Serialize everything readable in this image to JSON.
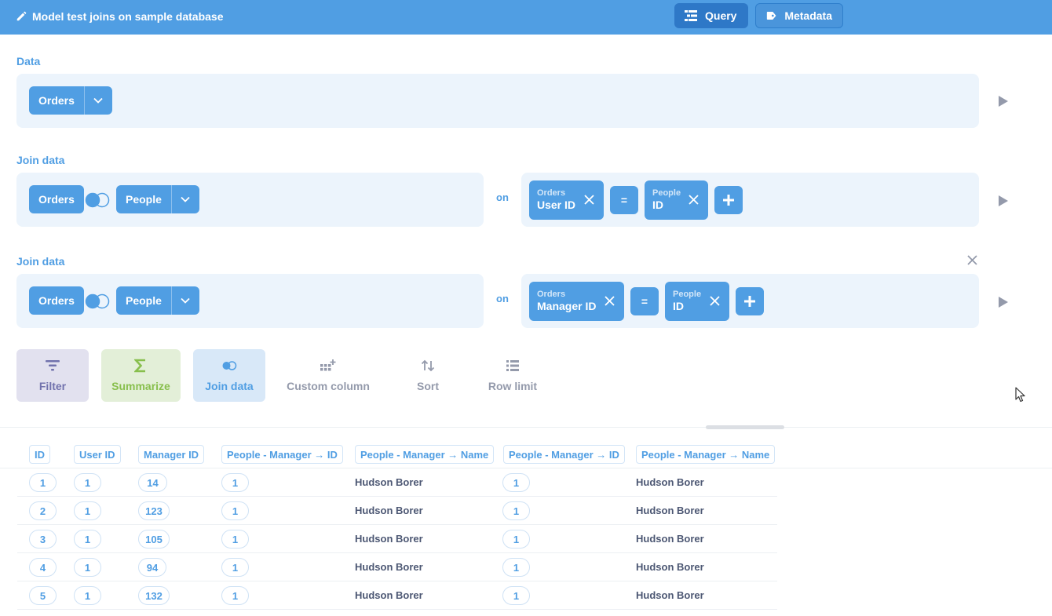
{
  "header": {
    "title": "Model test joins on sample database",
    "query_label": "Query",
    "metadata_label": "Metadata",
    "bg_color": "#509ee3"
  },
  "data_section": {
    "label": "Data",
    "table": "Orders"
  },
  "joins": [
    {
      "label": "Join data",
      "left_table": "Orders",
      "right_table": "People",
      "on_label": "on",
      "left_cond": {
        "table": "Orders",
        "field": "User ID"
      },
      "operator": "=",
      "right_cond": {
        "table": "People",
        "field": "ID"
      }
    },
    {
      "label": "Join data",
      "left_table": "Orders",
      "right_table": "People",
      "on_label": "on",
      "left_cond": {
        "table": "Orders",
        "field": "Manager ID"
      },
      "operator": "=",
      "right_cond": {
        "table": "People",
        "field": "ID"
      }
    }
  ],
  "actions": {
    "filter": "Filter",
    "summarize": "Summarize",
    "join": "Join data",
    "custom_column": "Custom column",
    "sort": "Sort",
    "row_limit": "Row limit"
  },
  "table": {
    "columns": [
      "ID",
      "User ID",
      "Manager ID",
      "People - Manager → ID",
      "People - Manager → Name",
      "People - Manager → ID",
      "People - Manager → Name"
    ],
    "rows": [
      [
        "1",
        "1",
        "14",
        "1",
        "Hudson Borer",
        "1",
        "Hudson Borer"
      ],
      [
        "2",
        "1",
        "123",
        "1",
        "Hudson Borer",
        "1",
        "Hudson Borer"
      ],
      [
        "3",
        "1",
        "105",
        "1",
        "Hudson Borer",
        "1",
        "Hudson Borer"
      ],
      [
        "4",
        "1",
        "94",
        "1",
        "Hudson Borer",
        "1",
        "Hudson Borer"
      ],
      [
        "5",
        "1",
        "132",
        "1",
        "Hudson Borer",
        "1",
        "Hudson Borer"
      ]
    ]
  }
}
